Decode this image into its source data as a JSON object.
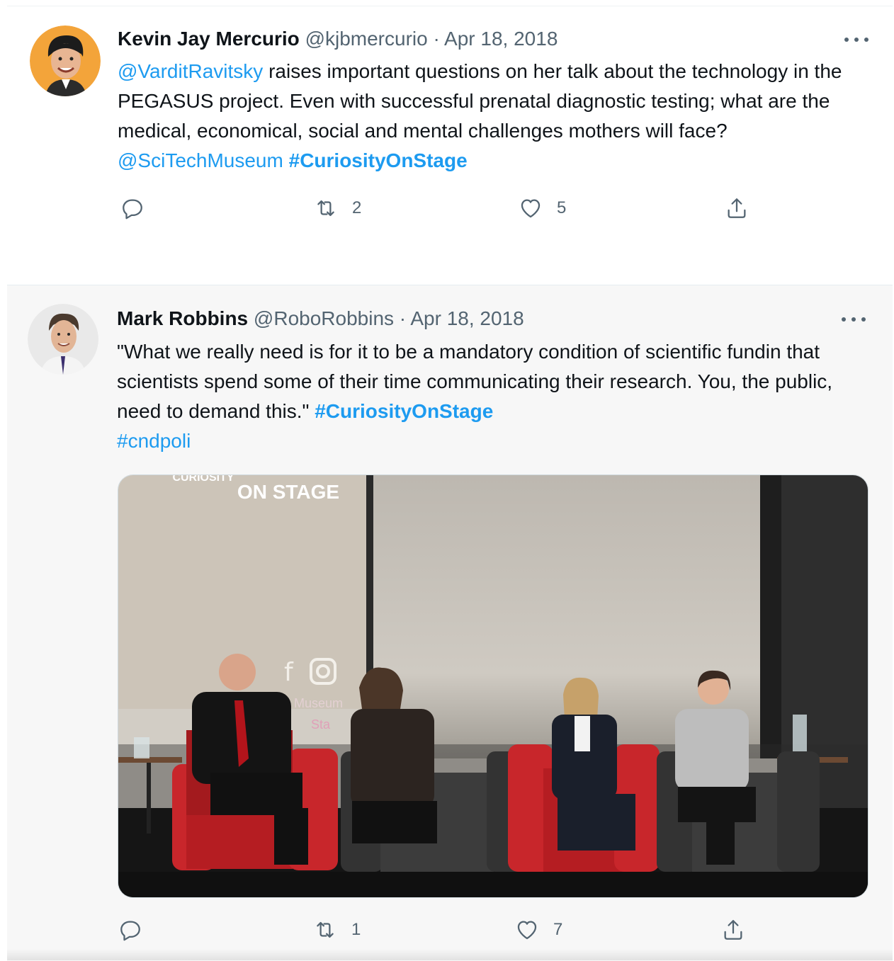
{
  "tweets": [
    {
      "name": "Kevin Jay Mercurio",
      "handle": "@kjbmercurio",
      "separator": "·",
      "date": "Apr 18, 2018",
      "text": {
        "mention1": "@VarditRavitsky",
        "body1": " raises important questions on her talk about the technology in the PEGASUS project. Even with successful prenatal diagnostic testing; what are the medical, economical, social and mental challenges mothers will face? ",
        "mention2": "@SciTechMuseum",
        "space": " ",
        "hashtag1": "#CuriosityOnStage"
      },
      "actions": {
        "reply_count": "",
        "retweet_count": "2",
        "like_count": "5"
      }
    },
    {
      "name": "Mark Robbins",
      "handle": "@RoboRobbins",
      "separator": "·",
      "date": "Apr 18, 2018",
      "text": {
        "body1": "\"What we really need is for it to be a mandatory condition of scientific fundin that scientists spend some of their time communicating their research. You, the public, need to demand this.\" ",
        "hashtag1": "#CuriosityOnStage",
        "hashtag2": "#cndpoli"
      },
      "media": {
        "screen_text_small": "CURIOSITY",
        "screen_text_large": "ON STAGE",
        "screen_text_side1": "Museum",
        "screen_text_side2": "Sta"
      },
      "actions": {
        "reply_count": "",
        "retweet_count": "1",
        "like_count": "7"
      }
    }
  ],
  "colors": {
    "link": "#1d9bf0",
    "secondary": "#536471",
    "chair_red": "#c8262b"
  },
  "icons": [
    "more-icon",
    "reply-icon",
    "retweet-icon",
    "like-icon",
    "share-icon"
  ]
}
